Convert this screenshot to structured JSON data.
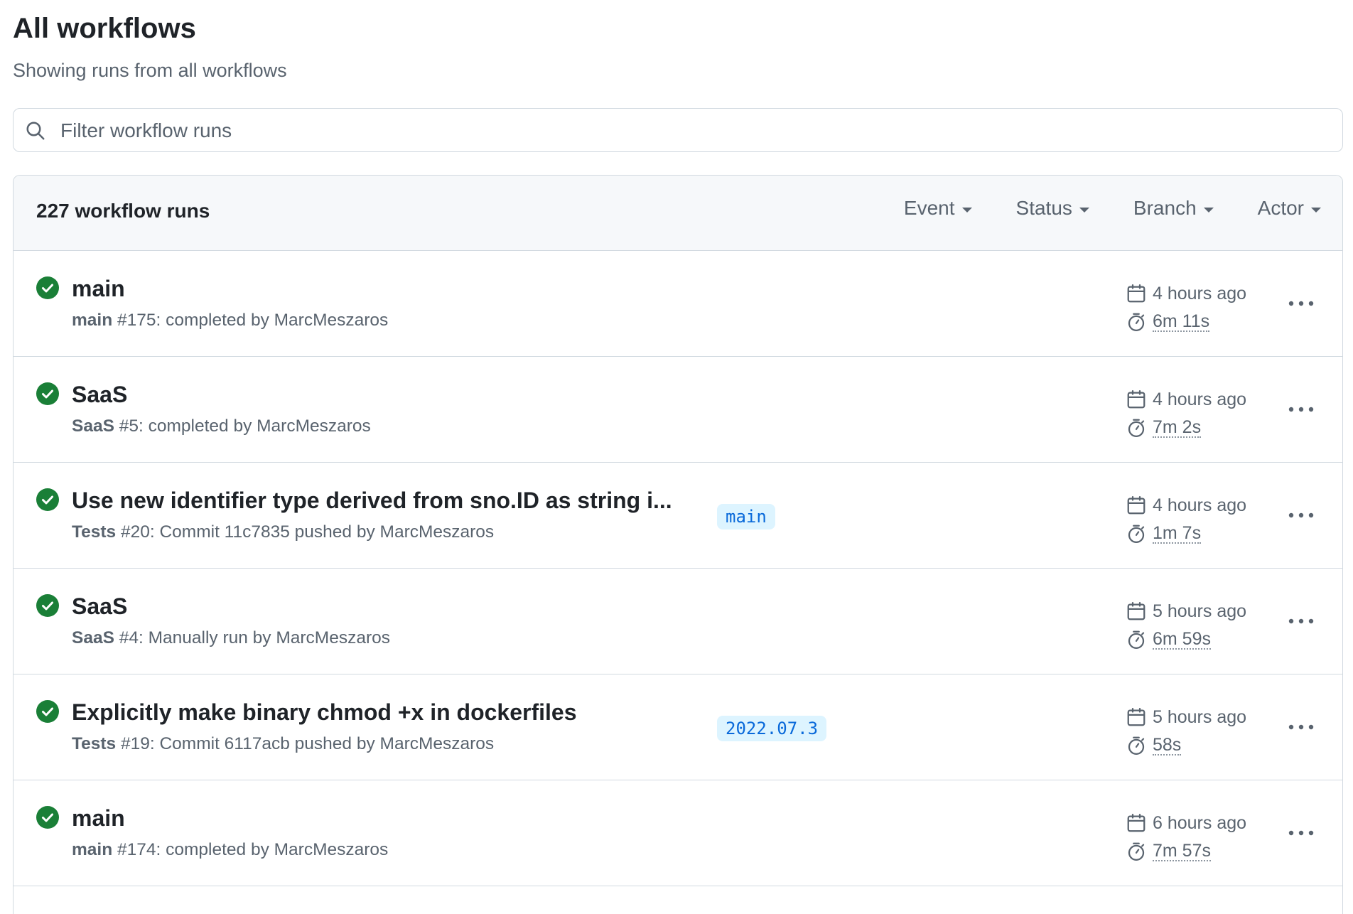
{
  "header": {
    "title": "All workflows",
    "subtitle": "Showing runs from all workflows"
  },
  "search": {
    "placeholder": "Filter workflow runs",
    "icon": "search-icon"
  },
  "runs_list": {
    "count_label": "227 workflow runs",
    "filters": [
      "Event",
      "Status",
      "Branch",
      "Actor"
    ],
    "runs": [
      {
        "status": "success",
        "title": "main",
        "workflow": "main",
        "meta": " #175: completed by MarcMeszaros",
        "branch": "",
        "time_ago": "4 hours ago",
        "duration": "6m 11s"
      },
      {
        "status": "success",
        "title": "SaaS",
        "workflow": "SaaS",
        "meta": " #5: completed by MarcMeszaros",
        "branch": "",
        "time_ago": "4 hours ago",
        "duration": "7m 2s"
      },
      {
        "status": "success",
        "title": "Use new identifier type derived from sno.ID as string i...",
        "workflow": "Tests",
        "meta": " #20: Commit 11c7835 pushed by MarcMeszaros",
        "branch": "main",
        "time_ago": "4 hours ago",
        "duration": "1m 7s"
      },
      {
        "status": "success",
        "title": "SaaS",
        "workflow": "SaaS",
        "meta": " #4: Manually run by MarcMeszaros",
        "branch": "",
        "time_ago": "5 hours ago",
        "duration": "6m 59s"
      },
      {
        "status": "success",
        "title": "Explicitly make binary chmod +x in dockerfiles",
        "workflow": "Tests",
        "meta": " #19: Commit 6117acb pushed by MarcMeszaros",
        "branch": "2022.07.3",
        "time_ago": "5 hours ago",
        "duration": "58s"
      },
      {
        "status": "success",
        "title": "main",
        "workflow": "main",
        "meta": " #174: completed by MarcMeszaros",
        "branch": "",
        "time_ago": "6 hours ago",
        "duration": "7m 57s"
      }
    ]
  },
  "colors": {
    "success": "#1a7f37",
    "branch_bg": "#ddf4ff",
    "branch_text": "#0969da",
    "muted_text": "#59636e",
    "border": "#d1d9e0",
    "header_bg": "#f6f8fa"
  }
}
